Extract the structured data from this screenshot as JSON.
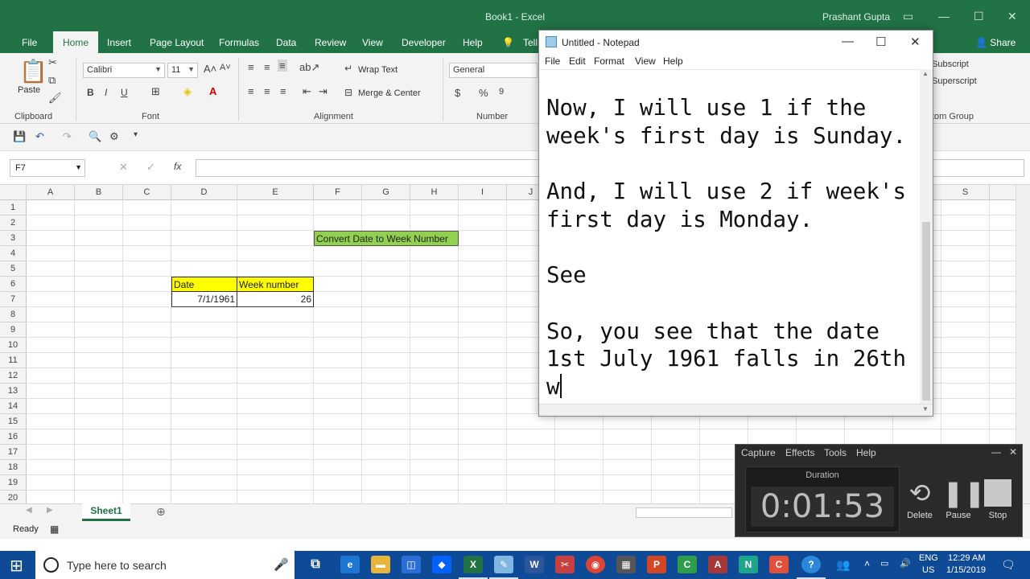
{
  "excel": {
    "window_title": "Book1  -  Excel",
    "user_name": "Prashant Gupta",
    "ribbon_tabs": [
      "File",
      "Home",
      "Insert",
      "Page Layout",
      "Formulas",
      "Data",
      "Review",
      "View",
      "Developer",
      "Help",
      "Tell"
    ],
    "share_label": "Share",
    "font_name": "Calibri",
    "font_size": "11",
    "number_format": "General",
    "wrap_text_label": "Wrap Text",
    "merge_label": "Merge & Center",
    "paste_label": "Paste",
    "subscript_label": "Subscript",
    "superscript_label": "Superscript",
    "groups": {
      "clipboard": "Clipboard",
      "font": "Font",
      "alignment": "Alignment",
      "number": "Number",
      "custom": "tom Group"
    },
    "name_box": "F7",
    "columns": [
      "A",
      "B",
      "C",
      "D",
      "E",
      "F",
      "G",
      "H",
      "I",
      "J",
      "S"
    ],
    "rows": [
      "1",
      "2",
      "3",
      "4",
      "5",
      "6",
      "7",
      "8",
      "9",
      "10",
      "11",
      "12",
      "13",
      "14",
      "15",
      "16",
      "17",
      "18",
      "19",
      "20"
    ],
    "cells": {
      "f3": "Convert Date to Week Number",
      "d6": "Date",
      "e6": "Week number",
      "d7": "7/1/1961",
      "e7": "26"
    },
    "sheet_tab": "Sheet1",
    "status": "Ready",
    "colors": {
      "accent": "#217346",
      "header_fill": "#ffff00",
      "title_fill": "#92d050"
    }
  },
  "notepad": {
    "title": "Untitled - Notepad",
    "menu": [
      "File",
      "Edit",
      "Format",
      "View",
      "Help"
    ],
    "lines": [
      "Now, I will use 1 if the",
      "week's first day is Sunday.",
      "",
      "And, I will use 2 if week's",
      "first day is Monday.",
      "",
      "See",
      "",
      "So, you see that the date",
      "1st July 1961 falls in 26th",
      "w"
    ]
  },
  "recorder": {
    "menu": [
      "Capture",
      "Effects",
      "Tools",
      "Help"
    ],
    "duration_label": "Duration",
    "time": "0:01:53",
    "buttons": [
      "Delete",
      "Pause",
      "Stop"
    ]
  },
  "taskbar": {
    "search_placeholder": "Type here to search",
    "lang_top": "ENG",
    "lang_bottom": "US",
    "time": "12:29 AM",
    "date": "1/15/2019"
  }
}
